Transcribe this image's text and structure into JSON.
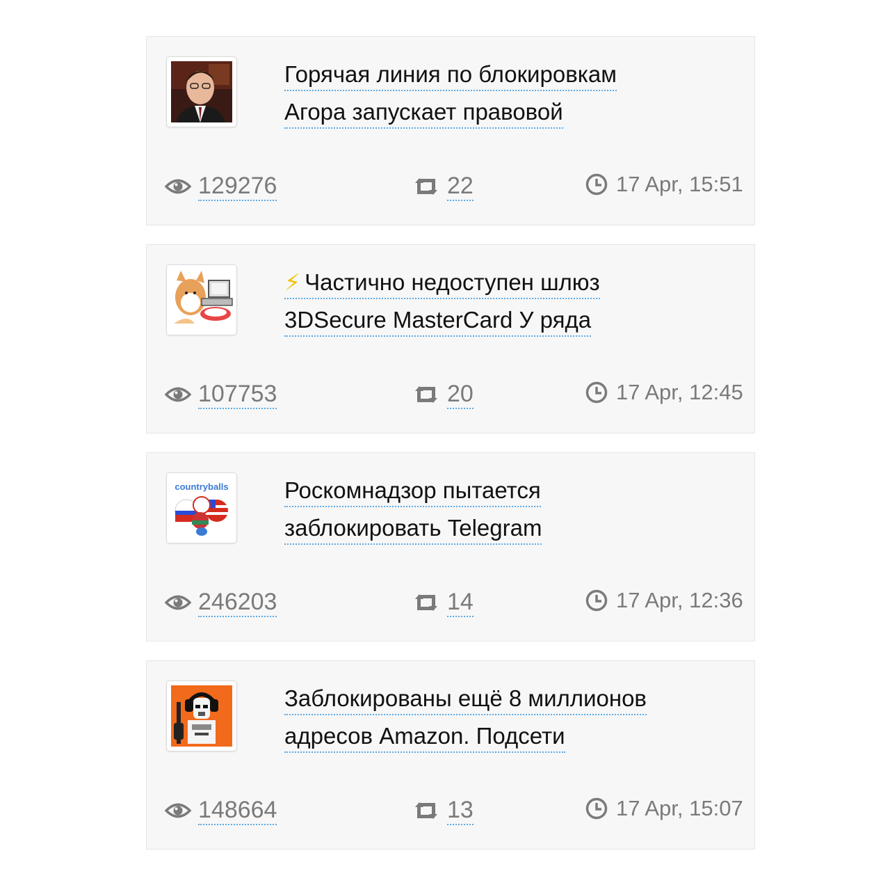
{
  "posts": [
    {
      "avatar_icon": "person-portrait-avatar",
      "title_lines": [
        "Горячая линия по блокировкам",
        "Агора запускает правовой"
      ],
      "views": "129276",
      "reposts": "22",
      "time": "17 Apr, 15:51"
    },
    {
      "avatar_icon": "cartoon-dog-computer-avatar",
      "bolt": "⚡",
      "title_lines": [
        "Частично недоступен шлюз",
        "3DSecure MasterCard У ряда"
      ],
      "views": "107753",
      "reposts": "20",
      "time": "17 Apr, 12:45"
    },
    {
      "avatar_icon": "countryballs-avatar",
      "avatar_text": "countryballs",
      "title_lines": [
        "Роскомнадзор пытается",
        "заблокировать Telegram"
      ],
      "views": "246203",
      "reposts": "14",
      "time": "17 Apr, 12:36"
    },
    {
      "avatar_icon": "stormtrooper-headphones-avatar",
      "title_lines": [
        "Заблокированы ещё 8 миллионов",
        "адресов Amazon. Подсети"
      ],
      "views": "148664",
      "reposts": "13",
      "time": "17 Apr, 15:07"
    }
  ],
  "colors": {
    "card_bg": "#f7f7f7",
    "meta_text": "#7a7a7a",
    "link_underline": "#5aa9e6",
    "bolt": "#f2c300"
  }
}
